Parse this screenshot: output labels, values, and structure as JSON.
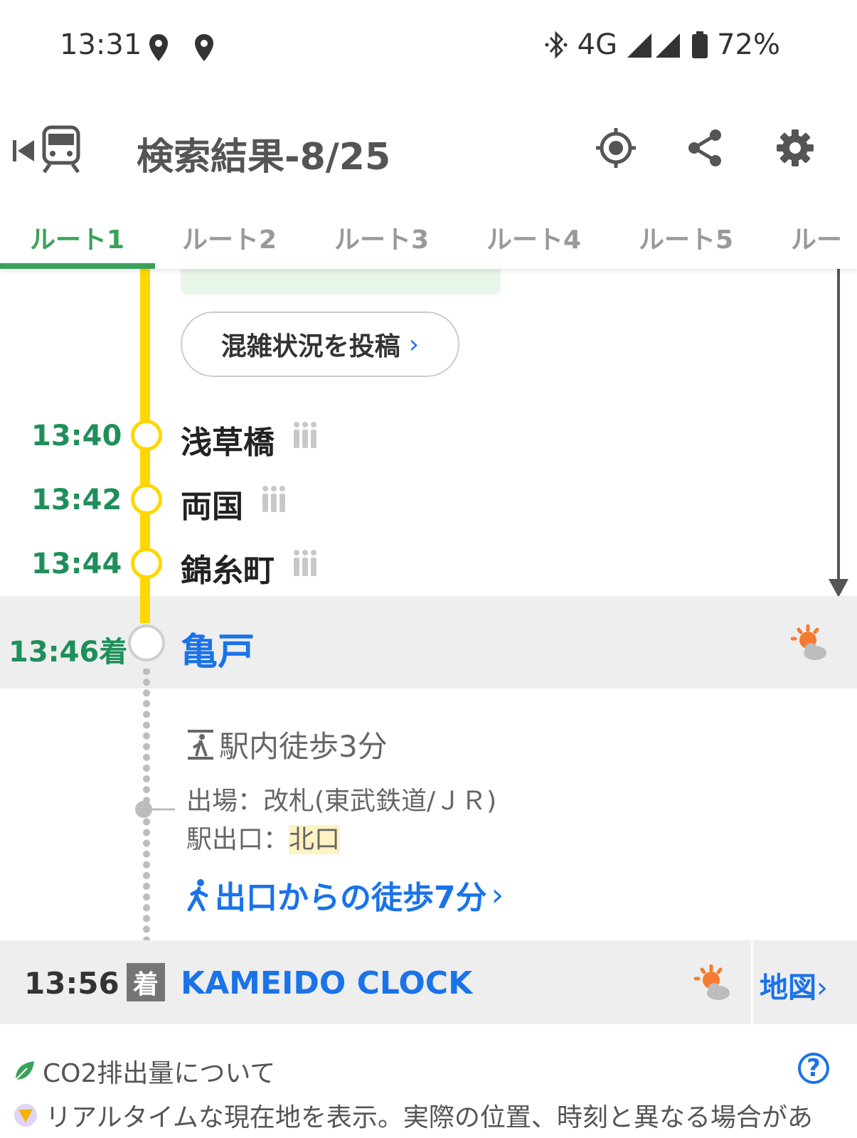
{
  "status_bar": {
    "time": "13:31",
    "network": "4G",
    "battery": "72%"
  },
  "header": {
    "title": "検索結果-8/25"
  },
  "tabs": [
    {
      "label": "ルート1"
    },
    {
      "label": "ルート2"
    },
    {
      "label": "ルート3"
    },
    {
      "label": "ルート4"
    },
    {
      "label": "ルート5"
    },
    {
      "label": "ルー"
    }
  ],
  "post_button": {
    "label": "混雑状況を投稿",
    "chevron": "›"
  },
  "stops": [
    {
      "time": "13:40",
      "name": "浅草橋"
    },
    {
      "time": "13:42",
      "name": "両国"
    },
    {
      "time": "13:44",
      "name": "錦糸町"
    }
  ],
  "arrival": {
    "time": "13:46着",
    "station": "亀戸"
  },
  "transfer": {
    "walk_title": "駅内徒歩3分",
    "exit_line1": "出場：改札(東武鉄道/ＪＲ)",
    "exit_line2_label": "駅出口：",
    "exit_line2_value": "北口",
    "walk_link": "出口からの徒歩7分",
    "walk_link_chevron": "›"
  },
  "destination": {
    "time": "13:56",
    "badge": "着",
    "name": "KAMEIDO CLOCK",
    "map_label": "地図",
    "map_chevron": "›"
  },
  "footer": {
    "co2_label": "CO2排出量について",
    "help": "?",
    "realtime_notice": "リアルタイムな現在地を表示。実際の位置、時刻と異なる場合があ"
  },
  "colors": {
    "accent_green": "#3aa15b",
    "time_green": "#1e8f5a",
    "line_yellow": "#ffd600",
    "link_blue": "#1a73e8",
    "weather_orange": "#f47c30"
  }
}
